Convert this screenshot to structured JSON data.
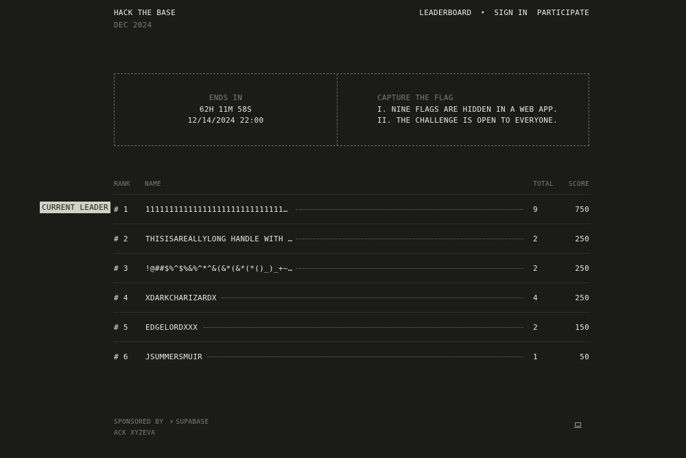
{
  "brand": {
    "title": "HACK THE BASE",
    "date": "DEC 2024"
  },
  "nav": {
    "leaderboard": "LEADERBOARD",
    "separator": "•",
    "sign_in": "SIGN IN",
    "participate": "PARTICIPATE"
  },
  "countdown": {
    "label": "ENDS IN",
    "remaining": "62H  11M  58S",
    "end_time": "12/14/2024 22:00"
  },
  "ctf": {
    "title": "CAPTURE THE FLAG",
    "rules": [
      "I. NINE FLAGS ARE HIDDEN IN A WEB APP.",
      "II. THE CHALLENGE IS OPEN TO EVERYONE."
    ]
  },
  "leaderboard": {
    "columns": {
      "rank": "RANK",
      "name": "NAME",
      "total": "TOTAL",
      "score": "SCORE"
    },
    "leader_badge": "CURRENT LEADER",
    "rows": [
      {
        "rank": "# 1",
        "name": "11111111111111111111111111111…",
        "total": "9",
        "score": "750"
      },
      {
        "rank": "# 2",
        "name": "THISISAREALLYLONG HANDLE WITH …",
        "total": "2",
        "score": "250"
      },
      {
        "rank": "# 3",
        "name": "!@##$%^$%&%^*^&(&*(&*(*()_)_+~…",
        "total": "2",
        "score": "250"
      },
      {
        "rank": "# 4",
        "name": "XDARKCHARIZARDX",
        "total": "4",
        "score": "250"
      },
      {
        "rank": "# 5",
        "name": "EDGELORDXXX",
        "total": "2",
        "score": "150"
      },
      {
        "rank": "# 6",
        "name": "JSUMMERSMUIR",
        "total": "1",
        "score": "50"
      }
    ]
  },
  "footer": {
    "sponsored_by": "SPONSORED BY",
    "sponsor": "SUPABASE",
    "ack": "ACK  XYZEVA",
    "sponsor_icon": "bolt-icon",
    "device_icon": "laptop-icon"
  }
}
